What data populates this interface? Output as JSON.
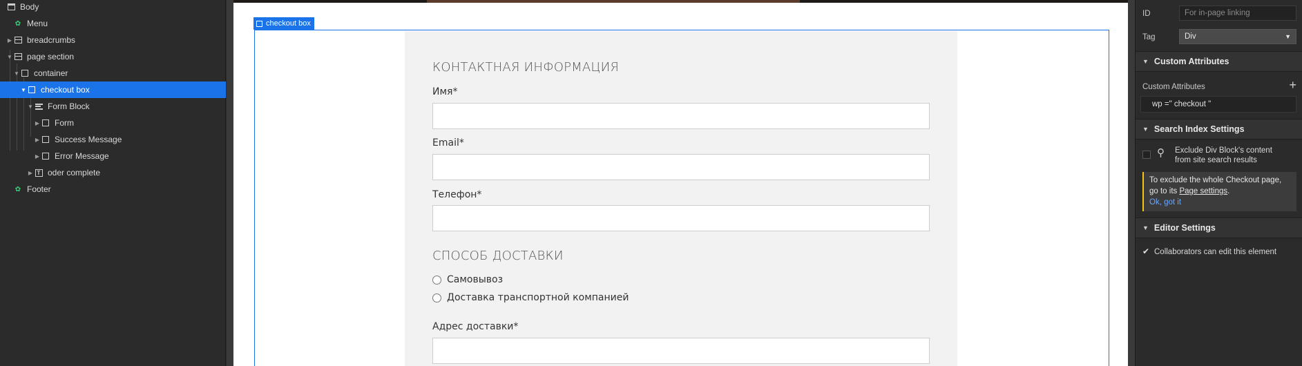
{
  "navigator": {
    "items": [
      {
        "label": "Body"
      },
      {
        "label": "Menu"
      },
      {
        "label": "breadcrumbs"
      },
      {
        "label": "page section"
      },
      {
        "label": "container"
      },
      {
        "label": "checkout box"
      },
      {
        "label": "Form Block"
      },
      {
        "label": "Form"
      },
      {
        "label": "Success Message"
      },
      {
        "label": "Error Message"
      },
      {
        "label": "oder complete"
      },
      {
        "label": "Footer"
      }
    ]
  },
  "canvas": {
    "selected_badge": "checkout box",
    "form": {
      "contact_heading": "КОНТАКТНАЯ ИНФОРМАЦИЯ",
      "name_label": "Имя*",
      "email_label": "Email*",
      "phone_label": "Телефон*",
      "delivery_heading": "СПОСОБ ДОСТАВКИ",
      "radio_pickup": "Самовывоз",
      "radio_transport": "Доставка транспортной компанией",
      "address_label": "Адрес доставки*"
    }
  },
  "settings": {
    "id_label": "ID",
    "id_placeholder": "For in-page linking",
    "tag_label": "Tag",
    "tag_value": "Div",
    "custom_attributes_header": "Custom Attributes",
    "custom_attributes_label": "Custom Attributes",
    "attribute_value": "wp =\" checkout \"",
    "search_index_header": "Search Index Settings",
    "exclude_line1": "Exclude Div Block's content",
    "exclude_line2": "from site search results",
    "info_line1": "To exclude the whole Checkout page,",
    "info_line2_prefix": "go to its ",
    "info_line2_link": "Page settings",
    "info_line2_suffix": ".",
    "info_action": "Ok, got it",
    "editor_settings_header": "Editor Settings",
    "collaborators_label": "Collaborators can edit this element",
    "collaborators_checked": true
  }
}
